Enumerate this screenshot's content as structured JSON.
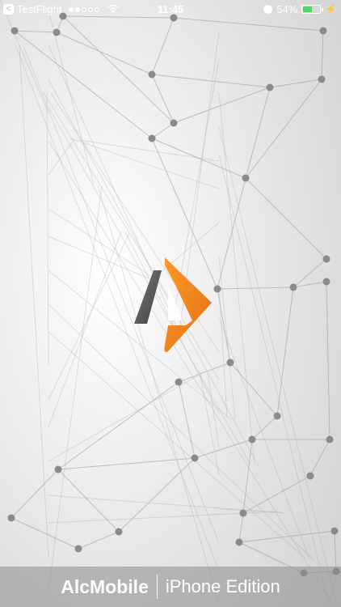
{
  "status_bar": {
    "back_app": "TestFlight",
    "time": "11:45",
    "battery_percent": "54%",
    "battery_level": 0.54,
    "signal_bars_filled": 2,
    "signal_bars_total": 5
  },
  "logo": {
    "name": "alcmobile-logo"
  },
  "footer": {
    "brand": "AlcMobile",
    "edition": "iPhone Edition"
  },
  "colors": {
    "accent": "#f28a1f",
    "logo_dark": "#5a5a5a",
    "footer_bg": "#8c8c8c",
    "battery": "#4cd964"
  }
}
